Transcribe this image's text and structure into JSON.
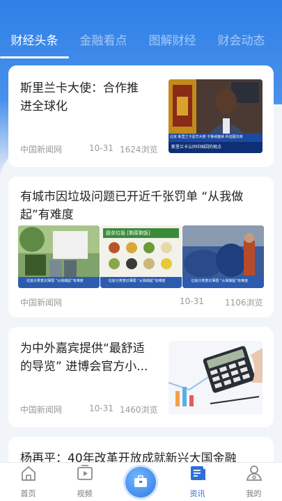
{
  "tabs": [
    {
      "label": "财经头条",
      "active": true
    },
    {
      "label": "金融看点",
      "active": false
    },
    {
      "label": "图解财经",
      "active": false
    },
    {
      "label": "财会动态",
      "active": false
    }
  ],
  "articles": [
    {
      "title_line1": "斯里兰卡大使：合作推",
      "title_line2": "进全球化",
      "source": "中国新闻网",
      "date": "10-31",
      "views": "1624浏览",
      "thumb_caption": "斯里兰卡认同中国因的观点",
      "thumb_caption_top": "北京  斯里兰卡驻华大使 卡鲁纳塞纳 科迪图瓦库"
    },
    {
      "title_line1": "有城市因垃圾问题已开近千张罚单 “从我做",
      "title_line2": "起”有难度",
      "source": "中国新闻网",
      "date": "10-31",
      "views": "1106浏览",
      "img_caption": "垃圾分类意识薄弱 “从我做起”有难度",
      "img2_header": "厨余垃圾 [剩菜剩饭]"
    },
    {
      "title_line1": "为中外嘉宾提供“最舒适",
      "title_line2": "的导览” 进博会官方小...",
      "source": "中国新闻网",
      "date": "10-31",
      "views": "1460浏览"
    },
    {
      "title_line1": "杨再平：40年改革开放成就新兴大国金融"
    }
  ],
  "tabbar": [
    {
      "label": "首页",
      "icon": "home-icon"
    },
    {
      "label": "视频",
      "icon": "video-icon"
    },
    {
      "label": "",
      "icon": "briefcase-icon"
    },
    {
      "label": "资讯",
      "icon": "news-icon"
    },
    {
      "label": "我的",
      "icon": "user-icon"
    }
  ],
  "colors": {
    "accent": "#2f6fd6",
    "header": "#2f80e8"
  }
}
